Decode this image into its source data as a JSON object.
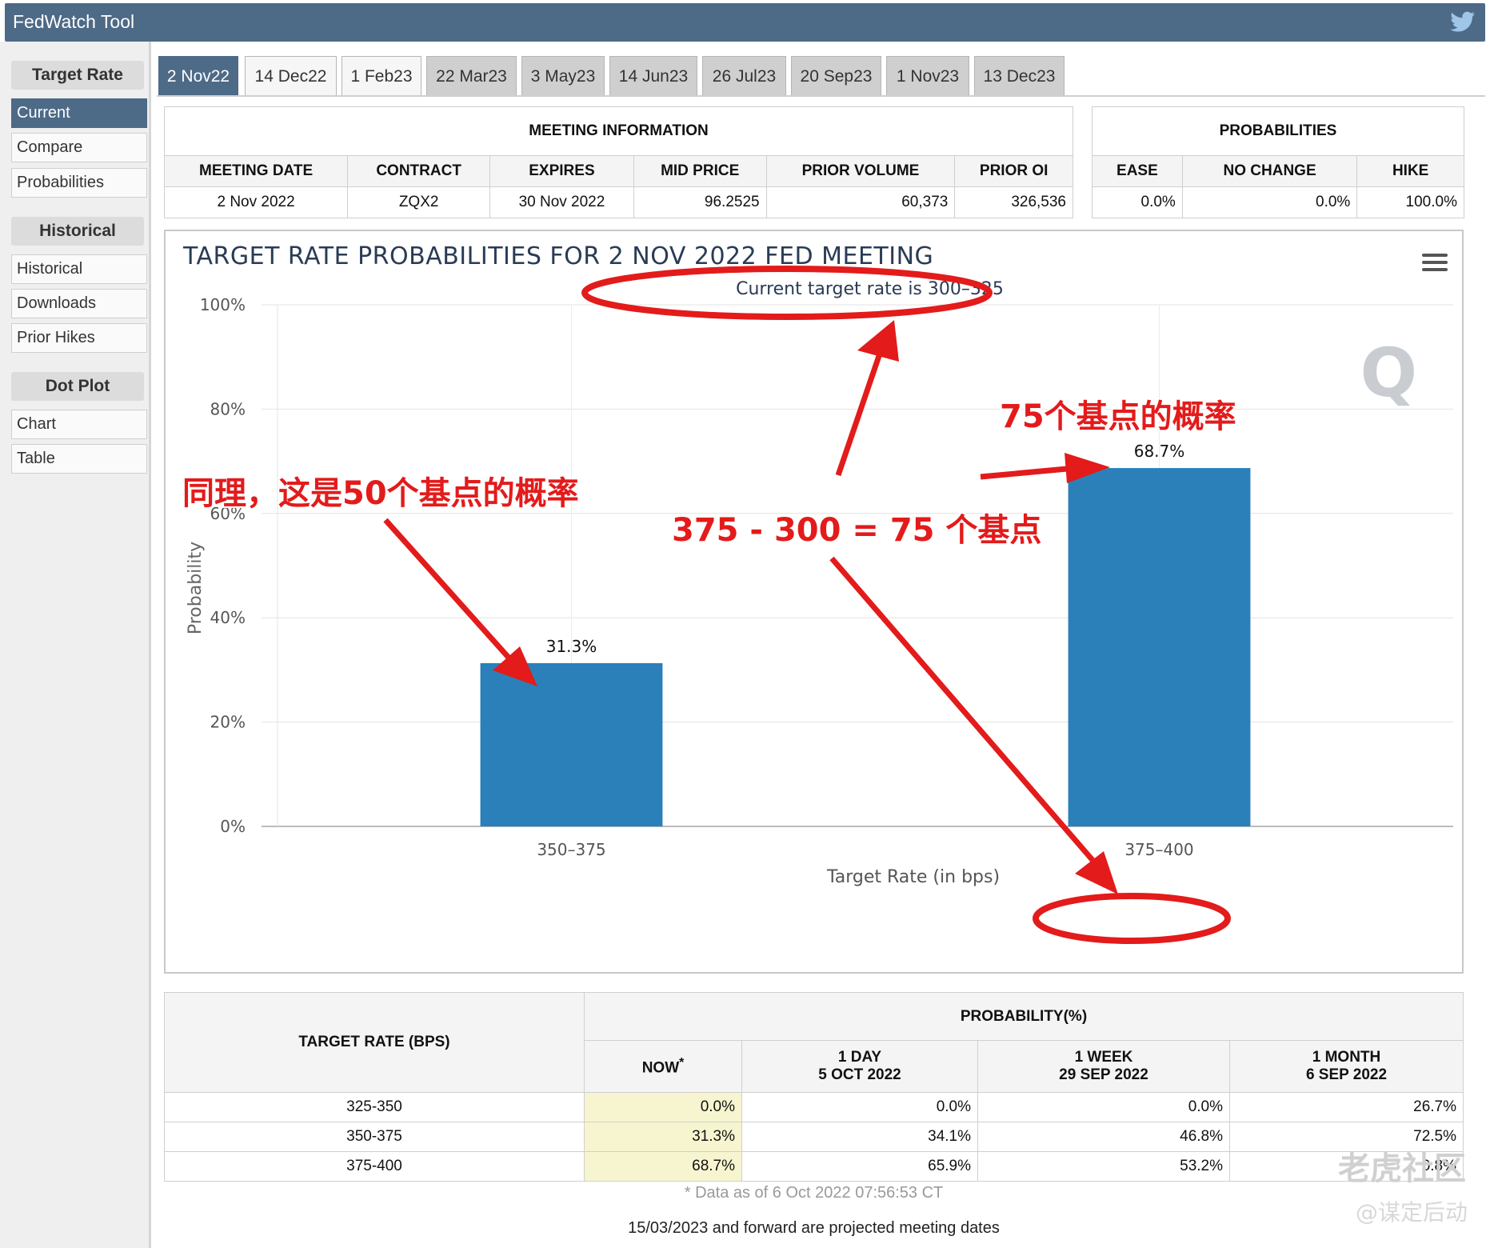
{
  "app": {
    "title": "FedWatch Tool"
  },
  "sidebar": {
    "sections": [
      {
        "header": "Target Rate",
        "items": [
          "Current",
          "Compare",
          "Probabilities"
        ]
      },
      {
        "header": "Historical",
        "items": [
          "Historical",
          "Downloads",
          "Prior Hikes"
        ]
      },
      {
        "header": "Dot Plot",
        "items": [
          "Chart",
          "Table"
        ]
      }
    ],
    "active_item": "Current"
  },
  "tabs": [
    "2 Nov22",
    "14 Dec22",
    "1 Feb23",
    "22 Mar23",
    "3 May23",
    "14 Jun23",
    "26 Jul23",
    "20 Sep23",
    "1 Nov23",
    "13 Dec23"
  ],
  "active_tab": "2 Nov22",
  "meeting_info": {
    "title": "MEETING INFORMATION",
    "headers": [
      "MEETING DATE",
      "CONTRACT",
      "EXPIRES",
      "MID PRICE",
      "PRIOR VOLUME",
      "PRIOR OI"
    ],
    "values": [
      "2 Nov 2022",
      "ZQX2",
      "30 Nov 2022",
      "96.2525",
      "60,373",
      "326,536"
    ]
  },
  "probabilities": {
    "title": "PROBABILITIES",
    "headers": [
      "EASE",
      "NO CHANGE",
      "HIKE"
    ],
    "values": [
      "0.0%",
      "0.0%",
      "100.0%"
    ]
  },
  "chart_data": {
    "type": "bar",
    "title": "TARGET RATE PROBABILITIES FOR 2 NOV 2022 FED MEETING",
    "subtitle": "Current target rate is 300–325",
    "categories": [
      "350–375",
      "375–400"
    ],
    "values": [
      31.3,
      68.7
    ],
    "data_labels": [
      "31.3%",
      "68.7%"
    ],
    "xlabel": "Target Rate (in bps)",
    "ylabel": "Probability",
    "ylim": [
      0,
      100
    ],
    "yticks": [
      "0%",
      "20%",
      "40%",
      "60%",
      "80%",
      "100%"
    ],
    "bar_color": "#2b80b9",
    "grid": true
  },
  "annotations": {
    "label_75": "75个基点的概率",
    "label_50": "同理，这是50个基点的概率",
    "label_calc": "375 - 300 = 75 个基点",
    "color": "#e31b1b"
  },
  "bottom_table": {
    "target_rate_header": "TARGET RATE (BPS)",
    "probability_header": "PROBABILITY(%)",
    "columns": [
      {
        "line1": "NOW",
        "line2": "",
        "marker": "*"
      },
      {
        "line1": "1 DAY",
        "line2": "5 OCT 2022"
      },
      {
        "line1": "1 WEEK",
        "line2": "29 SEP 2022"
      },
      {
        "line1": "1 MONTH",
        "line2": "6 SEP 2022"
      }
    ],
    "rows": [
      {
        "rate": "325-350",
        "values": [
          "0.0%",
          "0.0%",
          "0.0%",
          "26.7%"
        ]
      },
      {
        "rate": "350-375",
        "values": [
          "31.3%",
          "34.1%",
          "46.8%",
          "72.5%"
        ]
      },
      {
        "rate": "375-400",
        "values": [
          "68.7%",
          "65.9%",
          "53.2%",
          "0.8%"
        ]
      }
    ],
    "footnote": "* Data as of 6 Oct 2022 07:56:53 CT"
  },
  "footer_note": "15/03/2023 and forward are projected meeting dates",
  "watermarks": {
    "site": "老虎社区",
    "author": "@谋定后动"
  },
  "colors": {
    "accent": "#4d6a87",
    "now_highlight": "#f7f5cf",
    "bar": "#2b80b9"
  }
}
